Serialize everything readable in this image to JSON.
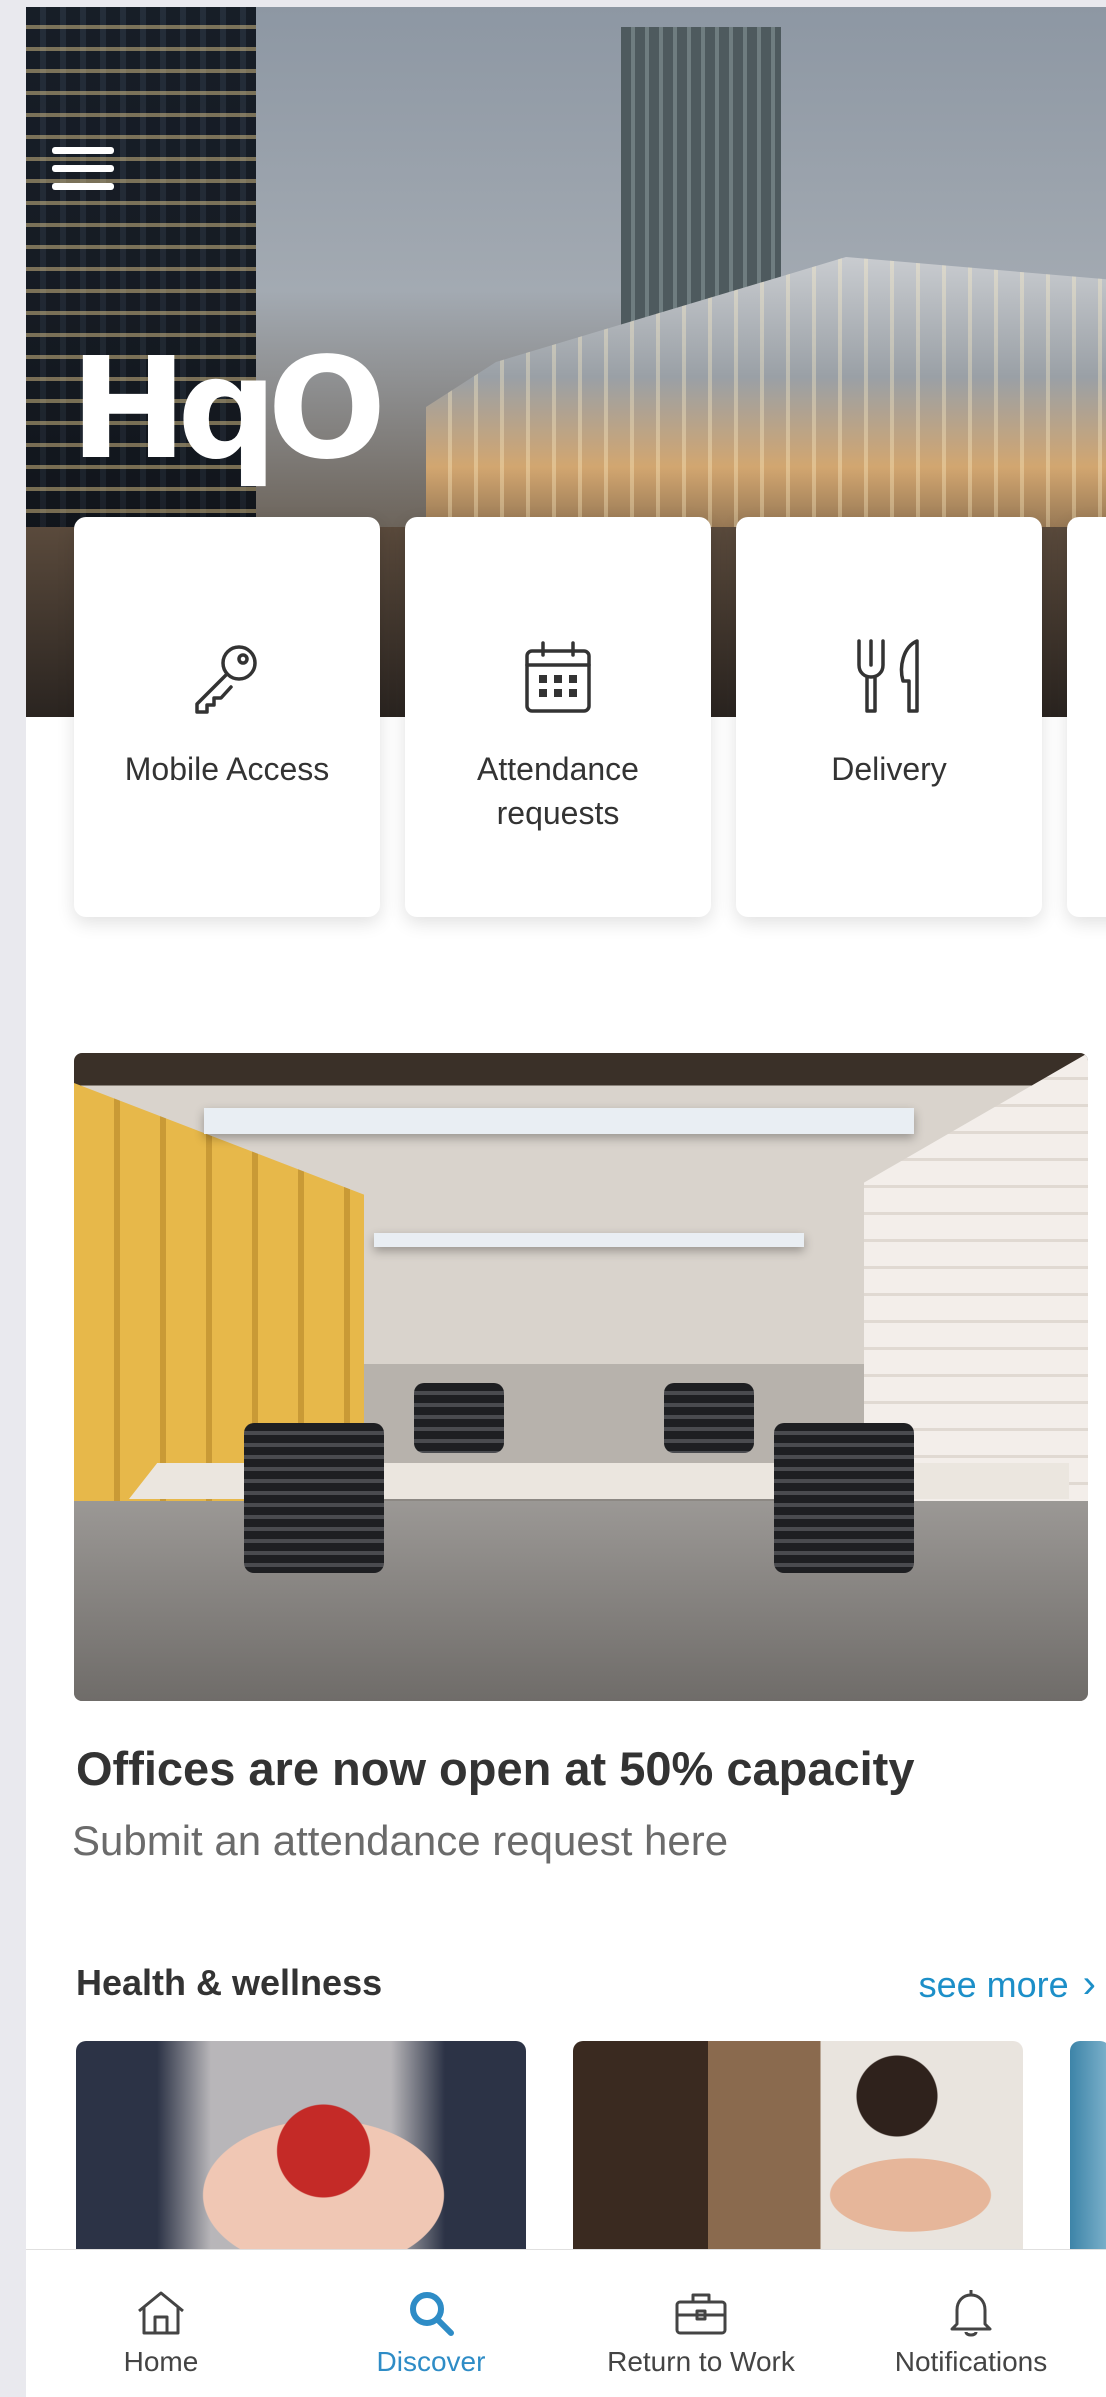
{
  "header": {
    "logo_text": "HqO",
    "menu_icon": "hamburger-menu-icon"
  },
  "quick_actions": [
    {
      "label": "Mobile Access",
      "icon": "key-icon"
    },
    {
      "label": "Attendance requests",
      "icon": "calendar-icon"
    },
    {
      "label": "Delivery",
      "icon": "fork-knife-icon"
    }
  ],
  "feature": {
    "title": "Offices are now open at 50% capacity",
    "subtitle": "Submit an attendance request here"
  },
  "health_section": {
    "title": "Health & wellness",
    "see_more": "see more"
  },
  "tabs": [
    {
      "label": "Home",
      "icon": "home-icon",
      "active": false
    },
    {
      "label": "Discover",
      "icon": "search-icon",
      "active": true
    },
    {
      "label": "Return to Work",
      "icon": "briefcase-icon",
      "active": false
    },
    {
      "label": "Notifications",
      "icon": "bell-icon",
      "active": false
    }
  ],
  "colors": {
    "accent": "#2E8CC6",
    "link": "#1C8FC8",
    "text": "#333333"
  }
}
